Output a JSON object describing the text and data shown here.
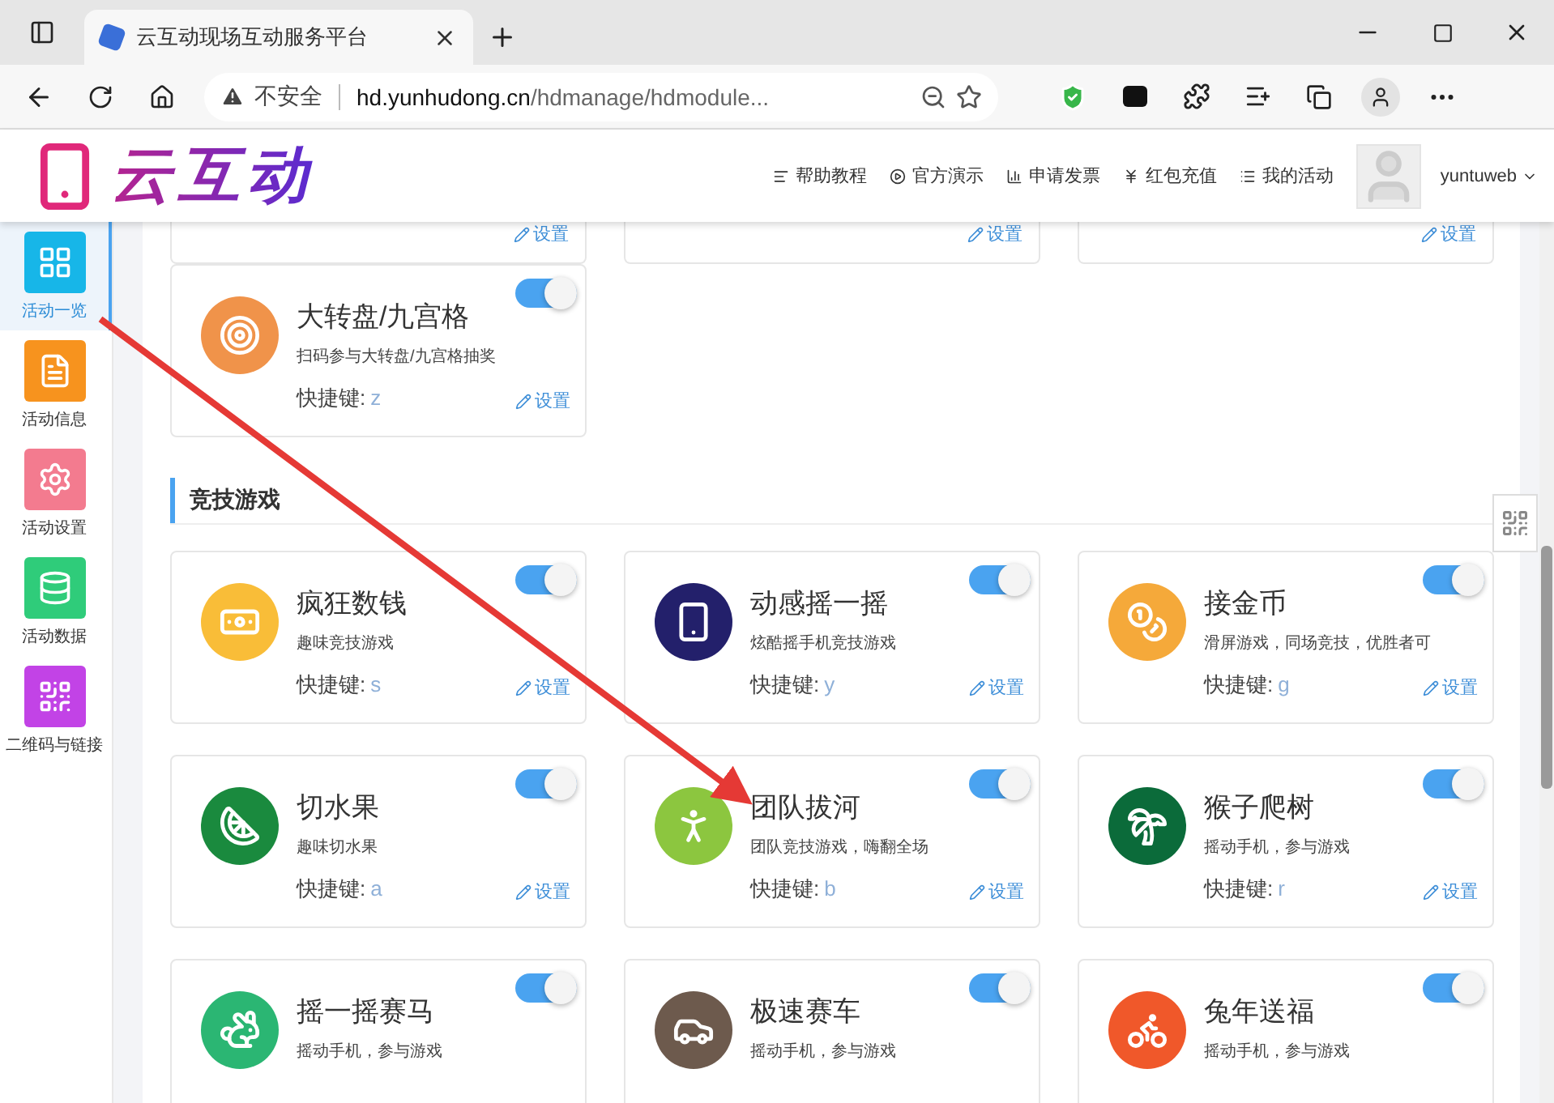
{
  "browser": {
    "tab_title": "云互动现场互动服务平台",
    "security": "不安全",
    "url_host": "hd.yunhudong.cn",
    "url_path": "/hdmanage/hdmodule..."
  },
  "header": {
    "logo": "云互动",
    "nav": [
      {
        "kind": "help",
        "label": "帮助教程"
      },
      {
        "kind": "demo",
        "label": "官方演示"
      },
      {
        "kind": "invoice",
        "label": "申请发票"
      },
      {
        "kind": "yen",
        "label": "红包充值"
      },
      {
        "kind": "list",
        "label": "我的活动"
      }
    ],
    "user": "yuntuweb"
  },
  "sidebar": {
    "items": [
      {
        "kind": "grid",
        "label": "活动一览",
        "color": "#17b6e8",
        "selected": true
      },
      {
        "kind": "file",
        "label": "活动信息",
        "color": "#f7931e",
        "selected": false
      },
      {
        "kind": "gear",
        "label": "活动设置",
        "color": "#f37b8f",
        "selected": false
      },
      {
        "kind": "database",
        "label": "活动数据",
        "color": "#2fcc7a",
        "selected": false
      },
      {
        "kind": "qr",
        "label": "二维码与链接",
        "color": "#c243e6",
        "selected": false
      }
    ]
  },
  "partial_cards": [
    {
      "settings": "设置"
    },
    {
      "settings": "设置"
    },
    {
      "settings": "设置"
    }
  ],
  "sections": [
    {
      "cards": [
        {
          "kind": "wheel",
          "color": "#f0934a",
          "title": "大转盘/九宫格",
          "description": "扫码参与大转盘/九宫格抽奖",
          "shortcut_label": "快捷键:",
          "shortcut": "z",
          "settings": "设置",
          "on": true
        }
      ]
    },
    {
      "title": "竞技游戏",
      "cards": [
        {
          "kind": "money",
          "color": "#f9bd38",
          "title": "疯狂数钱",
          "description": "趣味竞技游戏",
          "shortcut_label": "快捷键:",
          "shortcut": "s",
          "settings": "设置",
          "on": true
        },
        {
          "kind": "phone",
          "color": "#23206b",
          "title": "动感摇一摇",
          "description": "炫酷摇手机竞技游戏",
          "shortcut_label": "快捷键:",
          "shortcut": "y",
          "settings": "设置",
          "on": true
        },
        {
          "kind": "coins",
          "color": "#f5a93a",
          "title": "接金币",
          "description": "滑屏游戏，同场竞技，优胜者可",
          "shortcut_label": "快捷键:",
          "shortcut": "g",
          "settings": "设置",
          "on": true
        },
        {
          "kind": "fruit",
          "color": "#1a8a3e",
          "title": "切水果",
          "description": "趣味切水果",
          "shortcut_label": "快捷键:",
          "shortcut": "a",
          "settings": "设置",
          "on": true
        },
        {
          "kind": "person",
          "color": "#8cc63f",
          "title": "团队拔河",
          "description": "团队竞技游戏，嗨翻全场",
          "shortcut_label": "快捷键:",
          "shortcut": "b",
          "settings": "设置",
          "on": true
        },
        {
          "kind": "palm",
          "color": "#0b6b3a",
          "title": "猴子爬树",
          "description": "摇动手机，参与游戏",
          "shortcut_label": "快捷键:",
          "shortcut": "r",
          "settings": "设置",
          "on": true
        },
        {
          "kind": "horse",
          "color": "#2bb673",
          "title": "摇一摇赛马",
          "description": "摇动手机，参与游戏",
          "on": true
        },
        {
          "kind": "car",
          "color": "#6d5a4d",
          "title": "极速赛车",
          "description": "摇动手机，参与游戏",
          "on": true
        },
        {
          "kind": "bike",
          "color": "#f0582a",
          "title": "兔年送福",
          "description": "摇动手机，参与游戏",
          "on": true
        }
      ]
    }
  ]
}
